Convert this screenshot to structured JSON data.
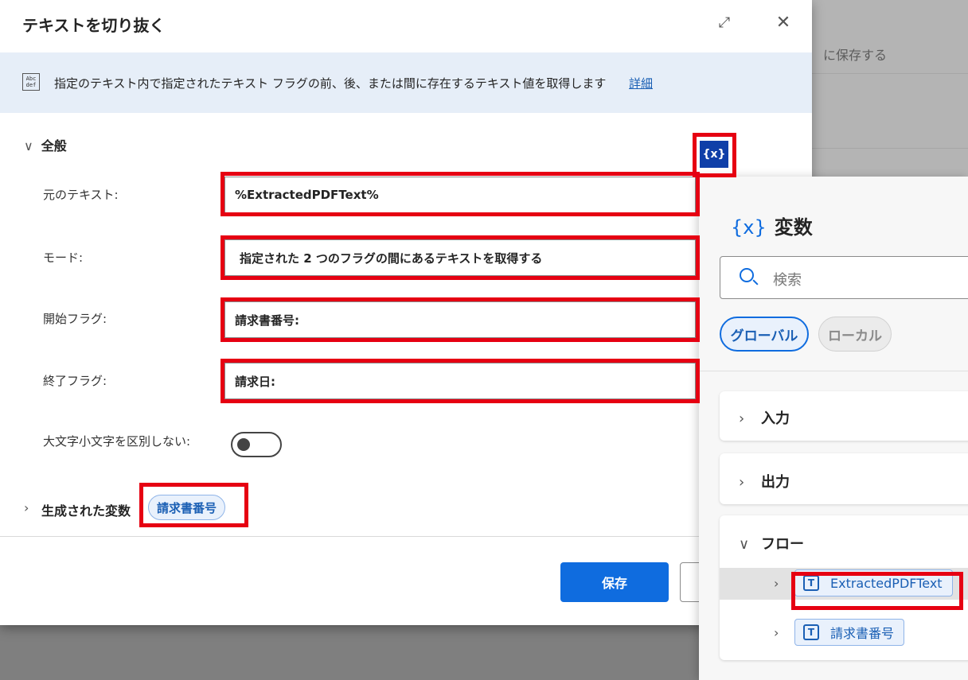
{
  "dialog": {
    "title": "テキストを切り抜く",
    "expand_icon": "expand-icon",
    "close_icon": "close-icon",
    "info": {
      "icon_text": "Abc def",
      "text": "指定のテキスト内で指定されたテキスト フラグの前、後、または間に存在するテキスト値を取得します",
      "link": "詳細"
    },
    "section_general": "全般",
    "fields": {
      "source_label": "元のテキスト:",
      "source_value": "%ExtractedPDFText%",
      "mode_label": "モード:",
      "mode_value": "指定された 2 つのフラグの間にあるテキストを取得する",
      "start_label": "開始フラグ:",
      "start_value": "請求書番号:",
      "end_label": "終了フラグ:",
      "end_value": "請求日:",
      "ignore_case_label": "大文字小文字を区別しない:"
    },
    "generated_label": "生成された変数",
    "generated_var": "請求書番号",
    "save": "保存",
    "var_button": "{x}"
  },
  "background": {
    "text": "に保存する"
  },
  "panel": {
    "title_icon": "{x}",
    "title": "変数",
    "search_placeholder": "検索",
    "tabs": [
      "グローバル",
      "ローカル"
    ],
    "groups": [
      "入力",
      "出力",
      "フロー"
    ],
    "flow_vars": [
      "ExtractedPDFText",
      "請求書番号"
    ],
    "var_type_icon": "T"
  },
  "colors": {
    "accent": "#0f6cdf",
    "highlight": "#e60012",
    "info_bg": "#e6eef8"
  }
}
